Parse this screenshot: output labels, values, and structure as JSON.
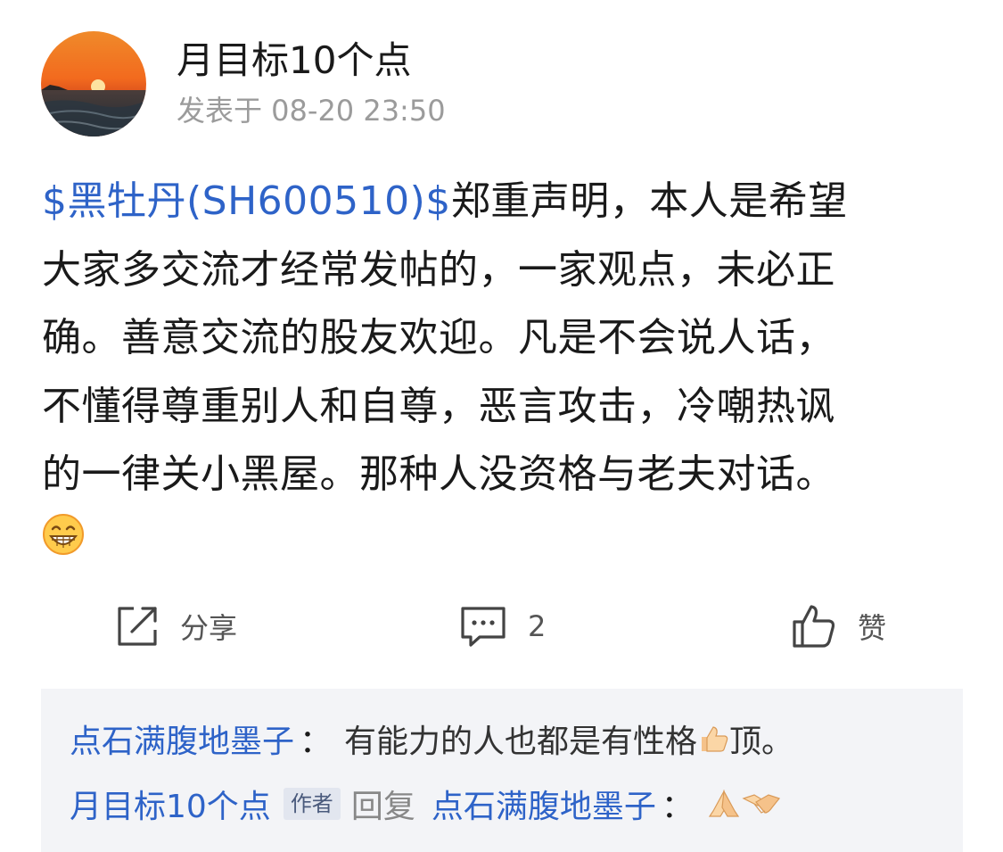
{
  "post": {
    "author_name": "月目标10个点",
    "timestamp": "发表于 08-20 23:50",
    "stock_tag": "$黑牡丹(SH600510)$",
    "body_lines": [
      "郑重声明，本人是希望",
      "大家多交流才经常发帖的，一家观点，未必正",
      "确。善意交流的股友欢迎。凡是不会说人话，",
      "不懂得尊重别人和自尊，恶言攻击，冷嘲热讽",
      "的一律关小黑屋。那种人没资格与老夫对话。"
    ],
    "trailing_emoji": "grinning-emoji"
  },
  "actions": {
    "share_label": "分享",
    "comment_count": "2",
    "like_label": "赞"
  },
  "comments": [
    {
      "user": "点石满腹地墨子",
      "colon": "：",
      "text_before": "有能力的人也都是有性格",
      "emoji": "thumbs-up-emoji",
      "text_after": "顶。"
    },
    {
      "user": "月目标10个点",
      "author_tag": "作者",
      "reply_word": "回复",
      "reply_to": "点石满腹地墨子",
      "colon": "：",
      "emojis": [
        "pray-emoji",
        "handshake-emoji"
      ]
    }
  ],
  "colors": {
    "link_blue": "#2e63c8",
    "meta_gray": "#9b9b9b",
    "comment_bg": "#f3f4f7"
  }
}
